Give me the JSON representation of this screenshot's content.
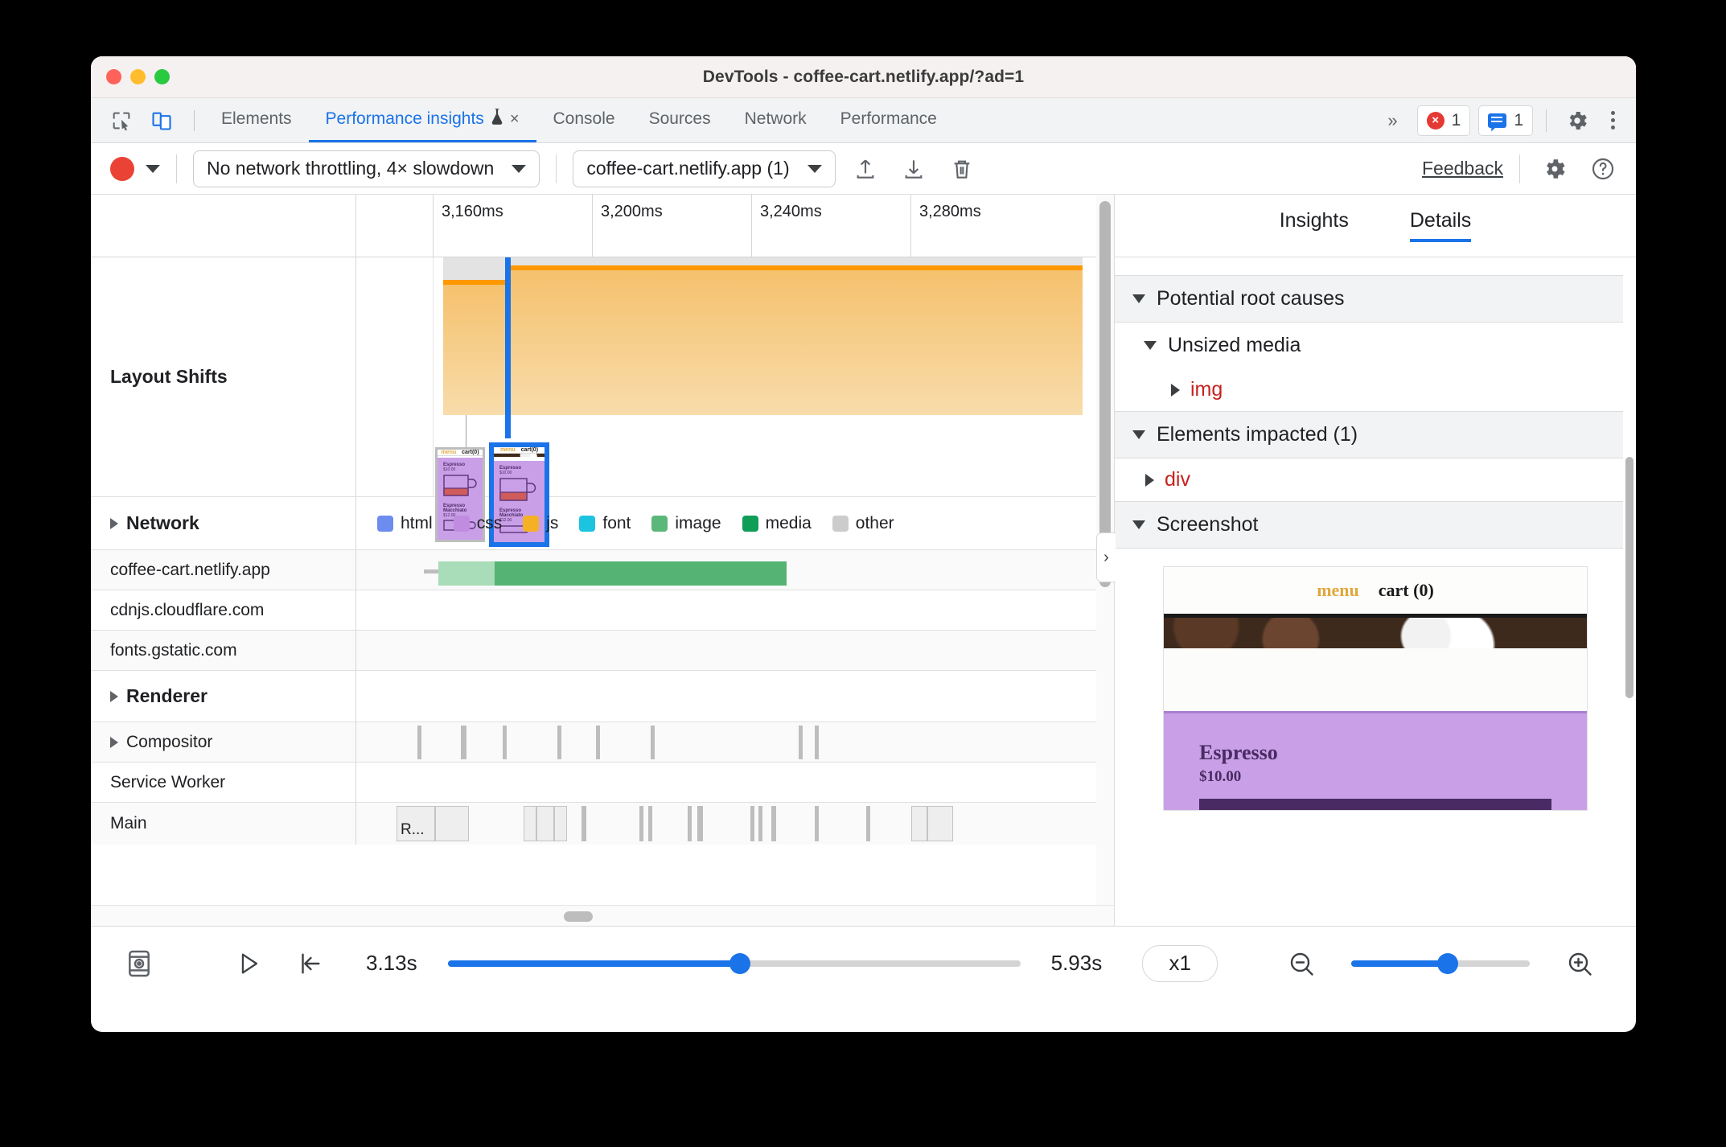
{
  "window": {
    "title": "DevTools - coffee-cart.netlify.app/?ad=1",
    "traffic_lights": [
      "close",
      "minimize",
      "zoom"
    ]
  },
  "tabbar": {
    "left_icons": [
      "inspect-element-icon",
      "device-toolbar-icon"
    ],
    "tabs": [
      {
        "label": "Elements",
        "active": false,
        "closable": false,
        "experimental": false
      },
      {
        "label": "Performance insights",
        "active": true,
        "closable": true,
        "experimental": true,
        "close_glyph": "×"
      },
      {
        "label": "Console",
        "active": false,
        "closable": false,
        "experimental": false
      },
      {
        "label": "Sources",
        "active": false,
        "closable": false,
        "experimental": false
      },
      {
        "label": "Network",
        "active": false,
        "closable": false,
        "experimental": false
      },
      {
        "label": "Performance",
        "active": false,
        "closable": false,
        "experimental": false
      }
    ],
    "overflow_glyph": "»",
    "error_count": "1",
    "message_count": "1",
    "settings_icon": "gear-icon",
    "more_icon": "kebab-menu-icon"
  },
  "toolbar": {
    "record_button": "record-button",
    "record_dropdown": "record-options-dropdown",
    "throttling_value": "No network throttling, 4× slowdown",
    "page_value": "coffee-cart.netlify.app (1)",
    "upload_icon": "upload-icon",
    "download_icon": "download-icon",
    "trash_icon": "trash-icon",
    "feedback_label": "Feedback",
    "settings_icon": "settings-gear-icon",
    "help_icon": "help-icon"
  },
  "timeline": {
    "ruler_ticks": [
      "3,160ms",
      "3,200ms",
      "3,240ms",
      "3,280ms"
    ],
    "tracks": [
      {
        "name": "Layout Shifts",
        "bold": true,
        "expandable": false
      },
      {
        "name": "Network",
        "bold": true,
        "expandable": true,
        "expanded": false
      },
      {
        "name": "coffee-cart.netlify.app",
        "bold": false,
        "expandable": false
      },
      {
        "name": "cdnjs.cloudflare.com",
        "bold": false,
        "expandable": false
      },
      {
        "name": "fonts.gstatic.com",
        "bold": false,
        "expandable": false
      },
      {
        "name": "Renderer",
        "bold": true,
        "expandable": true,
        "expanded": false
      },
      {
        "name": "Compositor",
        "bold": false,
        "expandable": true,
        "expanded": false
      },
      {
        "name": "Service Worker",
        "bold": false,
        "expandable": false
      },
      {
        "name": "Main",
        "bold": false,
        "expandable": false
      }
    ],
    "network_legend": [
      {
        "label": "html",
        "color": "#6c8cf0"
      },
      {
        "label": "css",
        "color": "#c08ce0"
      },
      {
        "label": "js",
        "color": "#f6b026"
      },
      {
        "label": "font",
        "color": "#1cc4e0"
      },
      {
        "label": "image",
        "color": "#5cb87a"
      },
      {
        "label": "media",
        "color": "#0f9d58"
      },
      {
        "label": "other",
        "color": "#cccccc"
      }
    ],
    "main_block_label": "R...",
    "selected_shift": "layout-shift-2"
  },
  "sidebar": {
    "tabs": [
      {
        "label": "Insights",
        "active": false
      },
      {
        "label": "Details",
        "active": true
      }
    ],
    "sections": [
      {
        "title": "Potential root causes",
        "expanded": true
      },
      {
        "title": "Unsized media",
        "expanded": true,
        "sub": true
      },
      {
        "title": "Elements impacted (1)",
        "expanded": true
      },
      {
        "title": "Screenshot",
        "expanded": true
      }
    ],
    "root_cause_items": [
      {
        "label": "img",
        "expanded": false
      }
    ],
    "impacted_items": [
      {
        "label": "div",
        "expanded": false
      }
    ],
    "collapse_glyph": "›",
    "screenshot": {
      "menu_label": "menu",
      "cart_label": "cart (0)",
      "product_title": "Espresso",
      "product_price": "$10.00"
    }
  },
  "bottombar": {
    "filmstrip_icon": "filmstrip-icon",
    "play_icon": "play-icon",
    "jump-to-start_icon": "jump-to-start-icon",
    "start_time": "3.13s",
    "end_time": "5.93s",
    "playback_rate": "x1",
    "zoom_out_icon": "zoom-out-icon",
    "zoom_in_icon": "zoom-in-icon",
    "progress_percent": 51,
    "zoom_percent": 54
  },
  "colors": {
    "accent": "#1a73e8",
    "record": "#ea4335",
    "shift_band": "#f5c06b",
    "shift_top": "#ff9800",
    "error_red": "#c5221f"
  }
}
